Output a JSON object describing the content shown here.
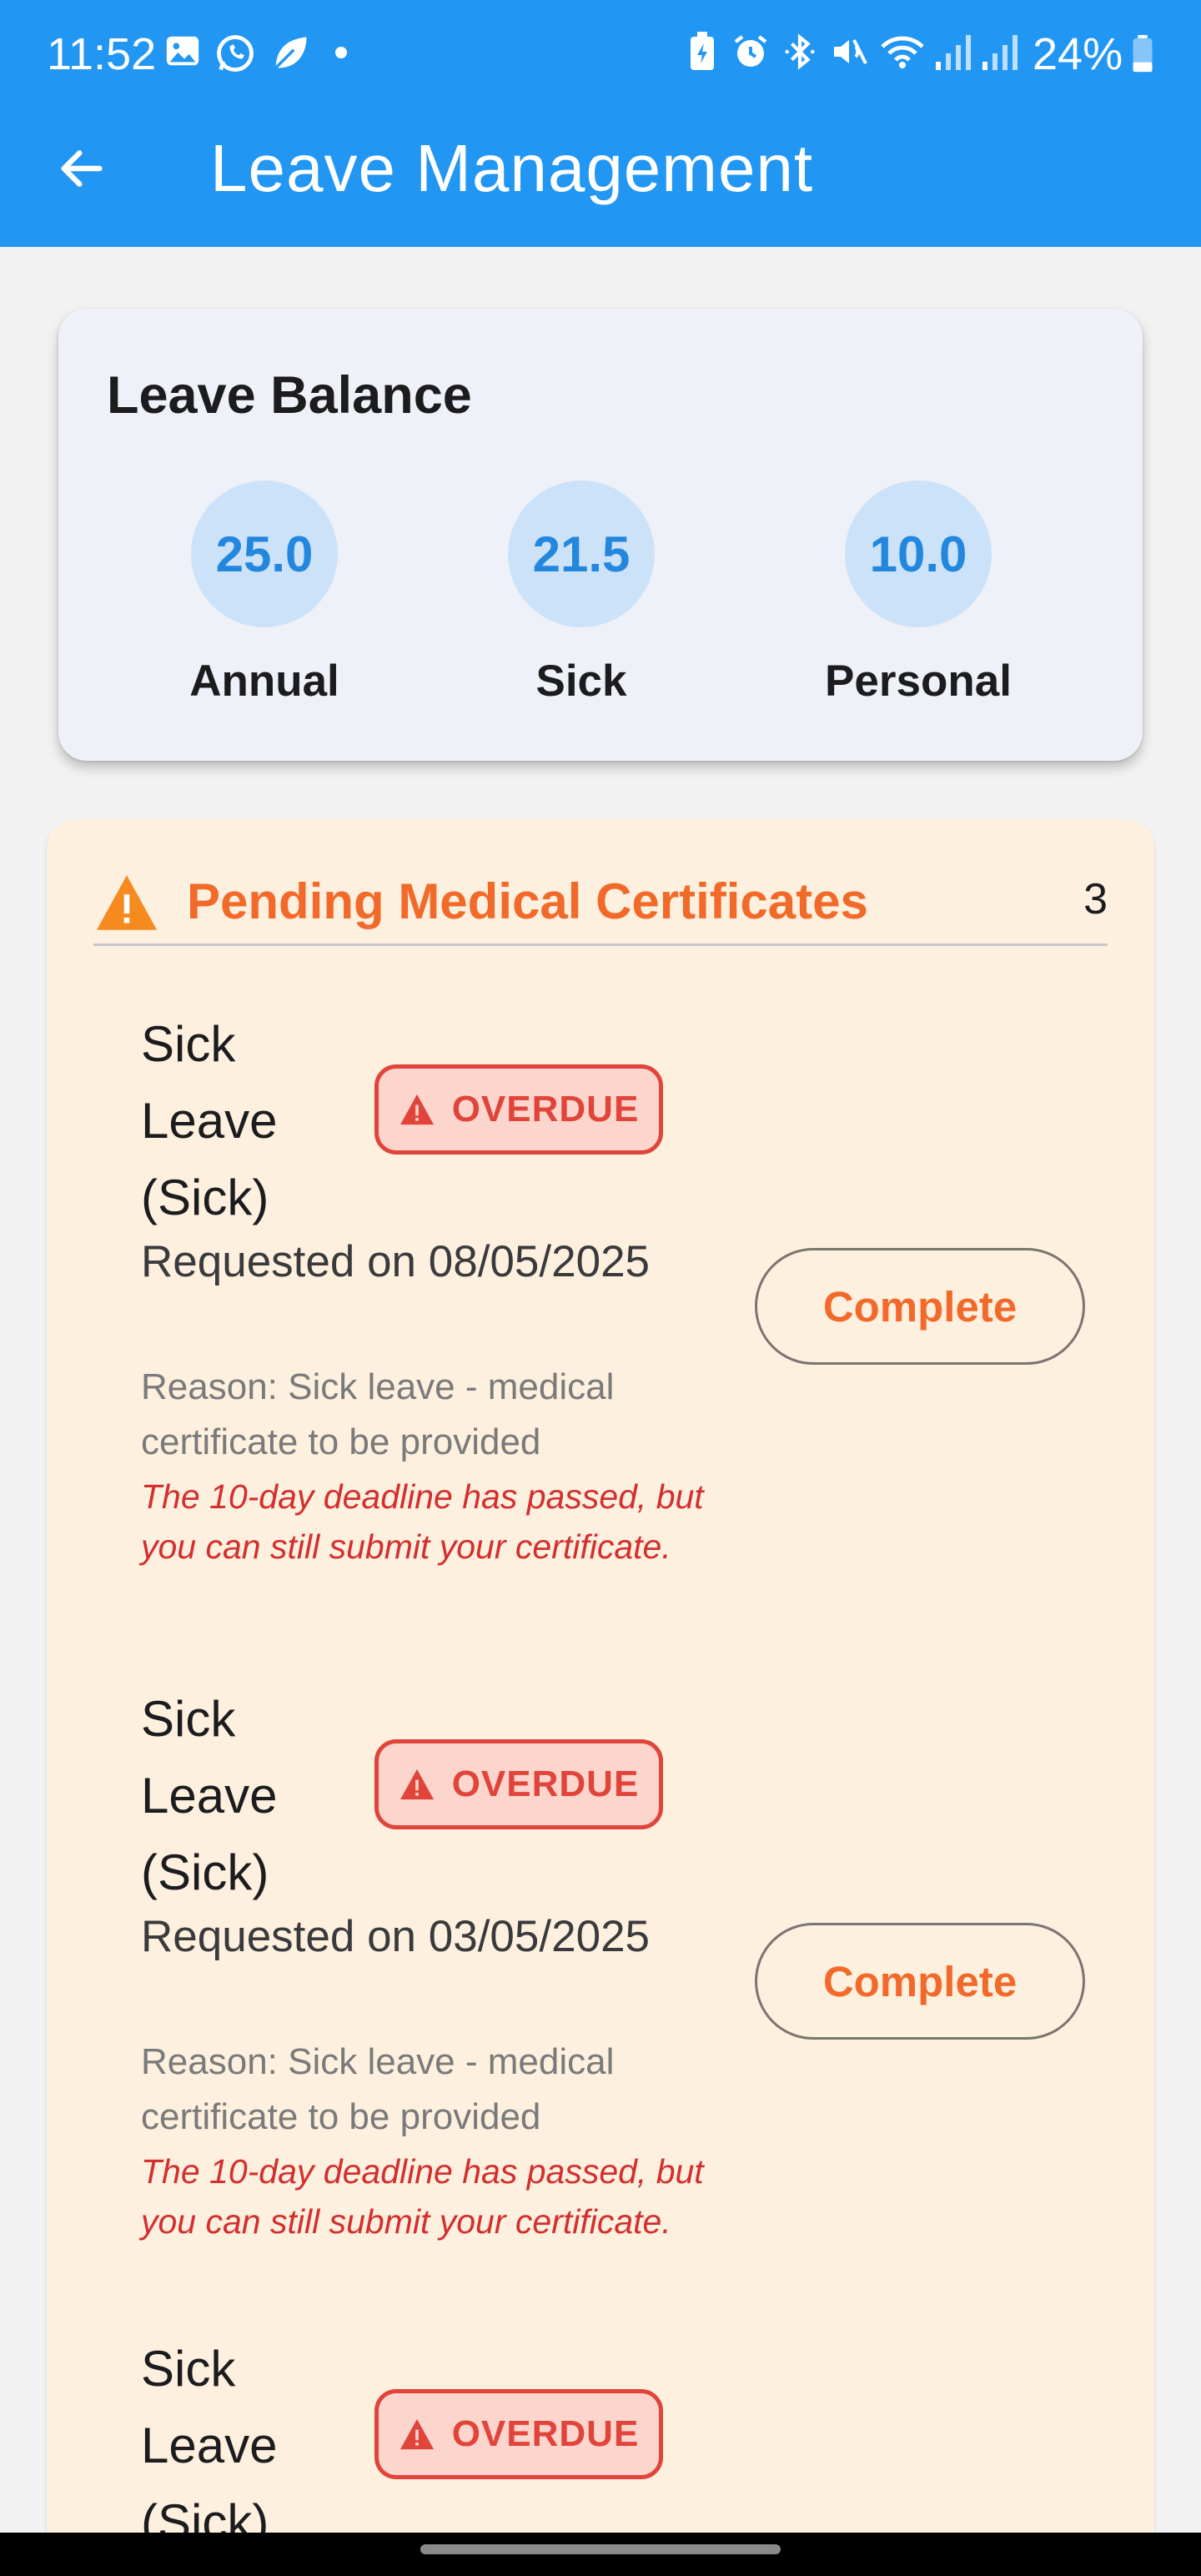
{
  "status_bar": {
    "time": "11:52",
    "battery": "24%",
    "icons": [
      "gallery-icon",
      "whatsapp-icon",
      "leaf-icon",
      "dot-icon",
      "battery-saver-icon",
      "alarm-icon",
      "bluetooth-icon",
      "mute-icon",
      "wifi-icon",
      "signal-icon",
      "signal-icon",
      "battery-icon"
    ]
  },
  "app_bar": {
    "title": "Leave Management",
    "back_icon": "arrow-left-icon",
    "color": "#2196f3"
  },
  "balance": {
    "title": "Leave Balance",
    "items": [
      {
        "value": "25.0",
        "label": "Annual"
      },
      {
        "value": "21.5",
        "label": "Sick"
      },
      {
        "value": "10.0",
        "label": "Personal"
      }
    ]
  },
  "pending": {
    "title": "Pending Medical Certificates",
    "count": "3",
    "icon": "warning-icon",
    "accent": "#f26a2a",
    "items": [
      {
        "type": "Sick Leave (Sick)",
        "badge": "OVERDUE",
        "requested": "Requested on 08/05/2025",
        "reason": "Reason: Sick leave - medical certificate to be provided",
        "note": "The 10-day deadline has passed, but you can still submit your certificate.",
        "button": "Complete"
      },
      {
        "type": "Sick Leave (Sick)",
        "badge": "OVERDUE",
        "requested": "Requested on 03/05/2025",
        "reason": "Reason: Sick leave - medical certificate to be provided",
        "note": "The 10-day deadline has passed, but you can still submit your certificate.",
        "button": "Complete"
      },
      {
        "type": "Sick Leave (Sick)",
        "badge": "OVERDUE"
      }
    ]
  }
}
